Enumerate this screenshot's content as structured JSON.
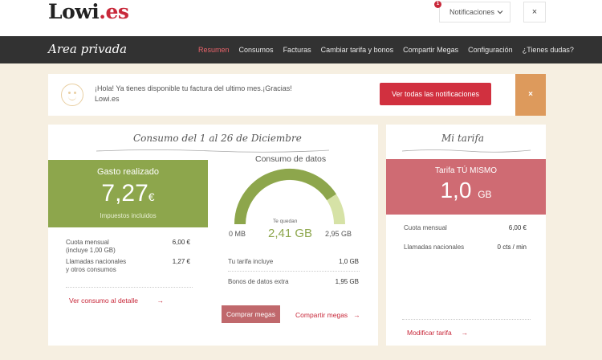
{
  "header": {
    "logo_main": "Lowi",
    "logo_suffix": ".es",
    "notifications_label": "Notificaciones",
    "notifications_count": "1",
    "close_label": "×"
  },
  "nav": {
    "area_title": "Area privada",
    "items": [
      "Resumen",
      "Consumos",
      "Facturas",
      "Cambiar tarifa y bonos",
      "Compartir Megas",
      "Configuración",
      "¿Tienes dudas?"
    ],
    "active_index": 0
  },
  "banner": {
    "message": "¡Hola! Ya tienes disponible tu factura del ultimo mes.¡Gracias!",
    "sender": "Lowi.es",
    "button_label": "Ver todas las notificaciones",
    "close_label": "×"
  },
  "consumo": {
    "title": "Consumo del 1 al 26 de Diciembre",
    "gasto": {
      "label": "Gasto realizado",
      "value": "7,27",
      "currency": "€",
      "note": "Impuestos incluidos"
    },
    "lines": [
      {
        "label": "Cuota mensual\n(incluye 1,00 GB)",
        "value": "6,00 €"
      },
      {
        "label": "Llamadas nacionales\ny otros consumos",
        "value": "1,27 €"
      }
    ],
    "detail_link": "Ver consumo al detalle",
    "datos": {
      "title": "Consumo de datos",
      "min_label": "0 MB",
      "max_label": "2,95 GB",
      "remaining_label": "Te quedan",
      "remaining_value": "2,41 GB",
      "used_fraction": 0.817,
      "rows": [
        {
          "label": "Tu tarifa incluye",
          "value": "1,0 GB"
        },
        {
          "label": "Bonos de datos extra",
          "value": "1,95 GB"
        }
      ],
      "buy_button": "Comprar megas",
      "share_link": "Compartir megas"
    }
  },
  "tarifa": {
    "title": "Mi tarifa",
    "name": "Tarifa TÚ MISMO",
    "value": "1,0",
    "unit": "GB",
    "rows": [
      {
        "label": "Cuota mensual",
        "value": "6,00 €"
      },
      {
        "label": "Llamadas nacionales",
        "value": "0 cts / min"
      }
    ],
    "modify_link": "Modificar tarifa"
  },
  "colors": {
    "brand_red": "#c8283a",
    "green": "#8da64c",
    "green_light": "#d6e2a6",
    "tarifa_pink": "#cf6b73",
    "banner_close": "#dd9a5c"
  }
}
